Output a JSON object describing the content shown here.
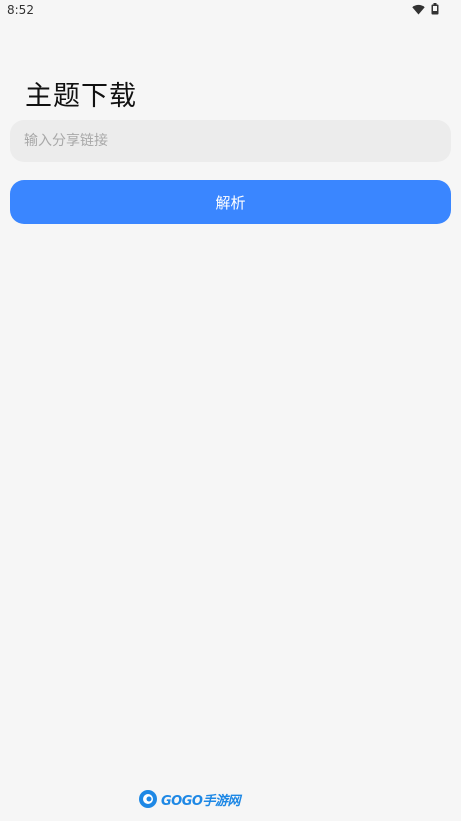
{
  "status_bar": {
    "time": "8:52",
    "wifi_icon": "wifi-icon",
    "battery_icon": "battery-icon"
  },
  "page": {
    "title": "主题下载"
  },
  "share_input": {
    "value": "",
    "placeholder": "输入分享链接"
  },
  "parse_button": {
    "label": "解析"
  },
  "watermark": {
    "text": "GOGO手游网",
    "icon": "gogo-logo-icon"
  },
  "colors": {
    "accent": "#3a86ff",
    "background": "#f6f6f6",
    "input_background": "#ececec"
  }
}
